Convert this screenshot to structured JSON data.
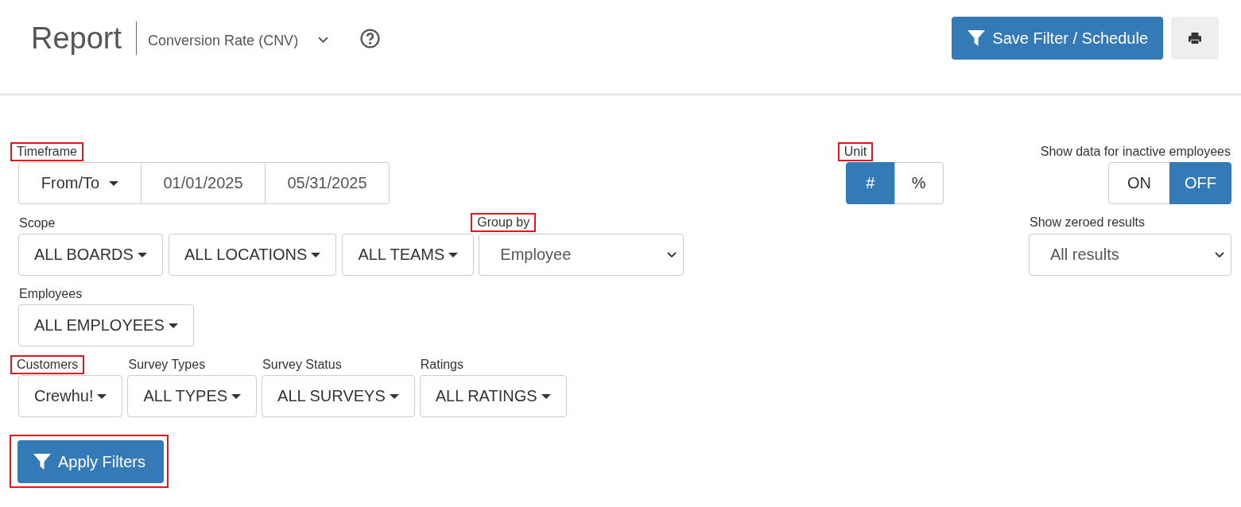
{
  "header": {
    "title": "Report",
    "report_select": "Conversion Rate (CNV)",
    "save_button": "Save Filter / Schedule"
  },
  "timeframe": {
    "label": "Timeframe",
    "highlighted": true,
    "mode": "From/To",
    "from": "01/01/2025",
    "to": "05/31/2025"
  },
  "unit": {
    "label": "Unit",
    "highlighted": true,
    "options": [
      {
        "label": "#",
        "selected": true
      },
      {
        "label": "%",
        "selected": false
      }
    ]
  },
  "inactive": {
    "label": "Show data for inactive employees",
    "highlighted": false,
    "options": [
      {
        "label": "ON",
        "selected": false
      },
      {
        "label": "OFF",
        "selected": true
      }
    ]
  },
  "scope": {
    "label": "Scope",
    "highlighted": false,
    "dropdowns": [
      "ALL BOARDS",
      "ALL LOCATIONS",
      "ALL TEAMS"
    ]
  },
  "group_by": {
    "label": "Group by",
    "highlighted": true,
    "value": "Employee"
  },
  "zeroed": {
    "label": "Show zeroed results",
    "highlighted": false,
    "value": "All results"
  },
  "employees": {
    "label": "Employees",
    "highlighted": false,
    "dropdowns": [
      "ALL EMPLOYEES"
    ]
  },
  "filter_row": [
    {
      "label": "Customers",
      "highlighted": true,
      "value": "Crewhu!"
    },
    {
      "label": "Survey Types",
      "highlighted": false,
      "value": "ALL TYPES"
    },
    {
      "label": "Survey Status",
      "highlighted": false,
      "value": "ALL SURVEYS"
    },
    {
      "label": "Ratings",
      "highlighted": false,
      "value": "ALL RATINGS"
    }
  ],
  "apply_button": {
    "label": "Apply Filters",
    "highlighted": true
  }
}
